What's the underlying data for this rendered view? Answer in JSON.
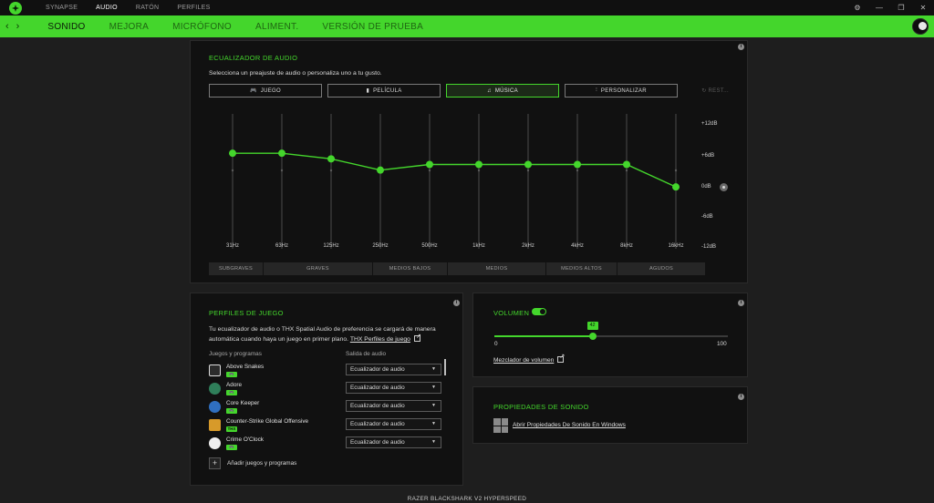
{
  "topnav": {
    "items": [
      "SYNAPSE",
      "AUDIO",
      "RATÓN",
      "PERFILES"
    ],
    "active": "AUDIO"
  },
  "window_controls": [
    "⚙",
    "—",
    "❐",
    "✕"
  ],
  "subtabs": {
    "items": [
      "SONIDO",
      "MEJORA",
      "MICRÓFONO",
      "ALIMENT.",
      "VERSIÓN DE PRUEBA"
    ],
    "active": "SONIDO"
  },
  "equalizer": {
    "title": "ECUALIZADOR DE AUDIO",
    "description": "Selecciona un preajuste de audio o personaliza uno a tu gusto.",
    "presets": [
      "JUEGO",
      "PELÍCULA",
      "MÚSICA",
      "PERSONALIZAR"
    ],
    "active_preset": "MÚSICA",
    "reset_label": "REST...",
    "bands": [
      "31Hz",
      "63Hz",
      "125Hz",
      "250Hz",
      "500Hz",
      "1kHz",
      "2kHz",
      "4kHz",
      "8kHz",
      "16kHz"
    ],
    "db_labels": [
      "+12dB",
      "+6dB",
      "0dB",
      "-6dB",
      "-12dB"
    ],
    "gains_db": [
      5,
      5,
      4,
      2,
      3,
      3,
      3,
      3,
      3,
      -1
    ],
    "ranges": [
      "SUBGRAVES",
      "GRAVES",
      "MEDIOS BAJOS",
      "MEDIOS",
      "MEDIOS ALTOS",
      "AGUDOS"
    ],
    "accent": "#44d62c"
  },
  "game_profiles": {
    "title": "PERFILES DE JUEGO",
    "description": "Tu ecualizador de audio o THX Spatial Audio de preferencia se cargará de manera automática cuando haya un juego en primer plano.",
    "thx_link": "THX Perfiles de juego",
    "col_games": "Juegos y programas",
    "col_output": "Salida de audio",
    "games": [
      {
        "name": "Above Snakes",
        "badge": "🎮",
        "output": "Ecualizador de audio",
        "icon_color": "#2b2b2b"
      },
      {
        "name": "Adore",
        "badge": "🎮",
        "output": "Ecualizador de audio",
        "icon_color": "#2f7f5a"
      },
      {
        "name": "Core Keeper",
        "badge": "🎮",
        "output": "Ecualizador de audio",
        "icon_color": "#2f6fc0"
      },
      {
        "name": "Counter-Strike Global Offensive",
        "badge": "THX",
        "output": "Ecualizador de audio",
        "icon_color": "#d79a2a"
      },
      {
        "name": "Crime O'Clock",
        "badge": "🎮",
        "output": "Ecualizador de audio",
        "icon_color": "#f0f0f0"
      }
    ],
    "add_label": "Añadir juegos y programas"
  },
  "volume": {
    "title": "VOLUMEN",
    "value": 42,
    "min": "0",
    "max": "100",
    "mixer_link": "Mezclador de volumen",
    "enabled": true
  },
  "sound_properties": {
    "title": "PROPIEDADES DE SONIDO",
    "link": "Abrir Propiedades De Sonido En Windows"
  },
  "footer": {
    "device": "RAZER BLACKSHARK V2 HYPERSPEED"
  }
}
